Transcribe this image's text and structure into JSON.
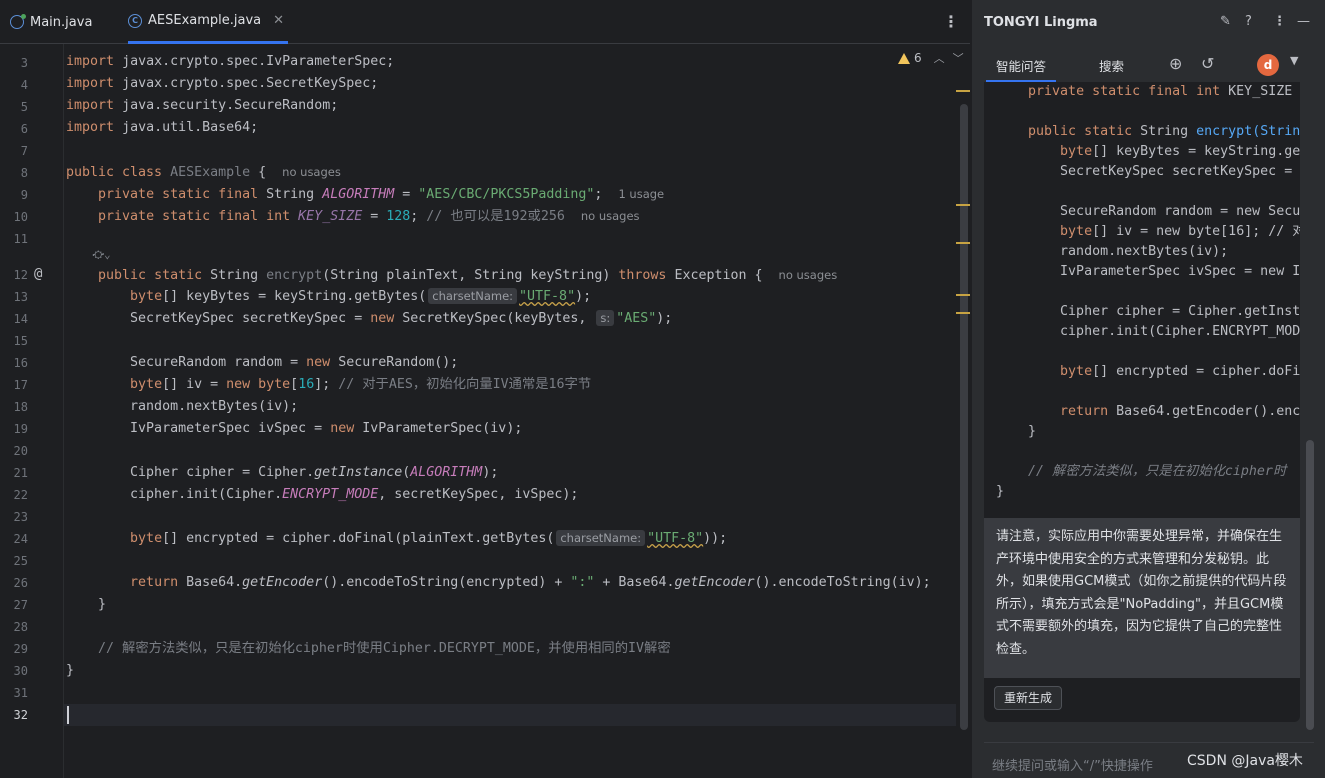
{
  "tabs": [
    {
      "label": "Main.java"
    },
    {
      "label": "AESExample.java"
    }
  ],
  "inspections": {
    "warnings": "6"
  },
  "editor": {
    "lines": [
      {
        "n": "3"
      },
      {
        "n": "4"
      },
      {
        "n": "5"
      },
      {
        "n": "6"
      },
      {
        "n": "7"
      },
      {
        "n": "8"
      },
      {
        "n": "9"
      },
      {
        "n": "10"
      },
      {
        "n": "11"
      },
      {
        "n": "12"
      },
      {
        "n": "13"
      },
      {
        "n": "14"
      },
      {
        "n": "15"
      },
      {
        "n": "16"
      },
      {
        "n": "17"
      },
      {
        "n": "18"
      },
      {
        "n": "19"
      },
      {
        "n": "20"
      },
      {
        "n": "21"
      },
      {
        "n": "22"
      },
      {
        "n": "23"
      },
      {
        "n": "24"
      },
      {
        "n": "25"
      },
      {
        "n": "26"
      },
      {
        "n": "27"
      },
      {
        "n": "28"
      },
      {
        "n": "29"
      },
      {
        "n": "30"
      },
      {
        "n": "31"
      },
      {
        "n": "32"
      }
    ],
    "code": {
      "l3": "javax.crypto.spec.IvParameterSpec;",
      "l4": "javax.crypto.spec.SecretKeySpec;",
      "l5": "java.security.SecureRandom;",
      "l6": "java.util.Base64;",
      "import_kw": "import",
      "class_name": "AESExample",
      "no_usages": "no usages",
      "one_usage": "1 usage",
      "algorithm": "ALGORITHM",
      "algorithm_value": "\"AES/CBC/PKCS5Padding\"",
      "key_size": "KEY_SIZE",
      "key_size_value": "128",
      "key_size_comment": "// 也可以是192或256",
      "charset_hint": "charsetName:",
      "s_hint": "s:",
      "utf8": "\"UTF-8\"",
      "aes": "\"AES\"",
      "iv_comment": "// 对于AES，初始化向量IV通常是16字节",
      "iv_len": "16",
      "colon_str": "\":\"",
      "decrypt_comment": "// 解密方法类似，只是在初始化cipher时使用Cipher.DECRYPT_MODE，并使用相同的IV解密"
    }
  },
  "panel": {
    "title": "TONGYI Lingma",
    "tabs": [
      {
        "label": "智能问答"
      },
      {
        "label": "搜索"
      }
    ],
    "avatar": "d",
    "code": {
      "p1": "KEY_SIZE",
      "p2": "encrypt(Strin",
      "p3": "keyBytes = keyString.ge",
      "p4": "SecretKeySpec secretKeySpec =",
      "p5": "SecureRandom random = new Secu",
      "p6": "iv = new byte[16]; // 对",
      "p7": "random.nextBytes(iv);",
      "p8": "IvParameterSpec ivSpec = new I",
      "p9": "Cipher cipher = Cipher.getInst",
      "p10": "cipher.init(Cipher.ENCRYPT_MOD",
      "p11": "encrypted = cipher.doFi",
      "p12": "Base64.getEncoder().enc",
      "p13": "// 解密方法类似，只是在初始化cipher时"
    },
    "note": "请注意，实际应用中你需要处理异常，并确保在生产环境中使用安全的方式来管理和分发秘钥。此外，如果使用GCM模式（如你之前提供的代码片段所示），填充方式会是\"NoPadding\"，并且GCM模式不需要额外的填充，因为它提供了自己的完整性检查。",
    "regenerate": "重新生成",
    "input_placeholder": "继续提问或输入“/”快捷操作"
  },
  "watermark": "CSDN @Java樱木"
}
